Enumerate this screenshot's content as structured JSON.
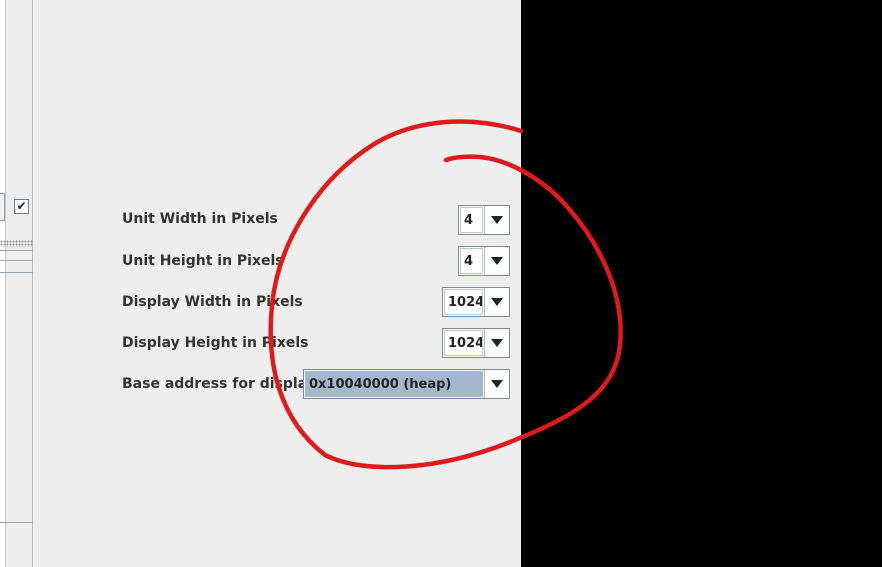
{
  "settings": {
    "unit_width": {
      "label": "Unit Width in Pixels",
      "value": "4"
    },
    "unit_height": {
      "label": "Unit Height in Pixels",
      "value": "4"
    },
    "display_width": {
      "label": "Display Width in Pixels",
      "value": "1024"
    },
    "display_height": {
      "label": "Display Height in Pixels",
      "value": "1024"
    },
    "base_address": {
      "label": "Base address for display",
      "value": "0x10040000 (heap)"
    }
  },
  "left_panel": {
    "checkbox_mark": "✔"
  },
  "colors": {
    "panel_bg": "#eeeeee",
    "display_bg": "#000000",
    "annotation_stroke": "#e01a1a",
    "selection_bg": "#a3b8cc"
  },
  "icons": {
    "dropdown": "chevron-down-icon",
    "annotation": "red-circle-annotation"
  }
}
